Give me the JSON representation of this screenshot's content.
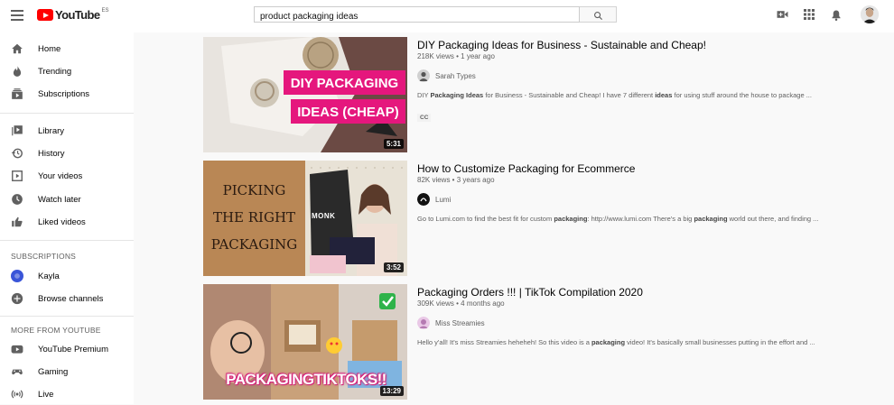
{
  "header": {
    "logo_text": "YouTube",
    "logo_region": "ES",
    "search_value": "product packaging ideas",
    "icons": [
      "menu-icon",
      "search-icon",
      "create-video-icon",
      "apps-icon",
      "notifications-icon",
      "avatar"
    ]
  },
  "sidebar": {
    "main": [
      {
        "label": "Home",
        "icon": "home-icon"
      },
      {
        "label": "Trending",
        "icon": "trending-icon"
      },
      {
        "label": "Subscriptions",
        "icon": "subscriptions-icon"
      }
    ],
    "library": [
      {
        "label": "Library",
        "icon": "library-icon"
      },
      {
        "label": "History",
        "icon": "history-icon"
      },
      {
        "label": "Your videos",
        "icon": "your-videos-icon"
      },
      {
        "label": "Watch later",
        "icon": "watch-later-icon"
      },
      {
        "label": "Liked videos",
        "icon": "liked-icon"
      }
    ],
    "subscriptions_heading": "SUBSCRIPTIONS",
    "subscriptions": [
      {
        "label": "Kayla",
        "icon": "channel-avatar"
      },
      {
        "label": "Browse channels",
        "icon": "add-circle-icon"
      }
    ],
    "more_heading": "MORE FROM YOUTUBE",
    "more": [
      {
        "label": "YouTube Premium",
        "icon": "youtube-premium-icon"
      },
      {
        "label": "Gaming",
        "icon": "gaming-icon"
      },
      {
        "label": "Live",
        "icon": "live-icon"
      }
    ]
  },
  "results": [
    {
      "title": "DIY Packaging Ideas for Business - Sustainable and Cheap!",
      "meta": "218K views • 1 year ago",
      "channel": "Sarah Types",
      "desc_parts": [
        "DIY ",
        "Packaging Ideas",
        " for Business - Sustainable and Cheap! I have 7 different ",
        "ideas",
        " for using stuff around the house to package ..."
      ],
      "badge": "CC",
      "duration": "5:31",
      "thumb_text": [
        "DIY PACKAGING",
        "IDEAS (CHEAP)"
      ]
    },
    {
      "title": "How to Customize Packaging for Ecommerce",
      "meta": "82K views • 3 years ago",
      "channel": "Lumi",
      "desc_parts": [
        "Go to Lumi.com to find the best fit for custom ",
        "packaging",
        ": http://www.lumi.com There's a big ",
        "packaging",
        " world out there, and finding ..."
      ],
      "duration": "3:52",
      "thumb_text": [
        "PICKING",
        "THE RIGHT",
        "PACKAGING"
      ],
      "thumb_brand": "MONK"
    },
    {
      "title": "Packaging Orders !!! | TikTok Compilation 2020",
      "meta": "309K views • 4 months ago",
      "channel": "Miss Streamies",
      "desc_parts": [
        "Hello y'all! It's miss Streamies heheheh! So this video is a ",
        "packaging",
        " video! It's basically small businesses putting in the effort and ..."
      ],
      "duration": "13:29",
      "thumb_text": [
        "PACKAGINGTIKTOKS!!"
      ]
    }
  ]
}
